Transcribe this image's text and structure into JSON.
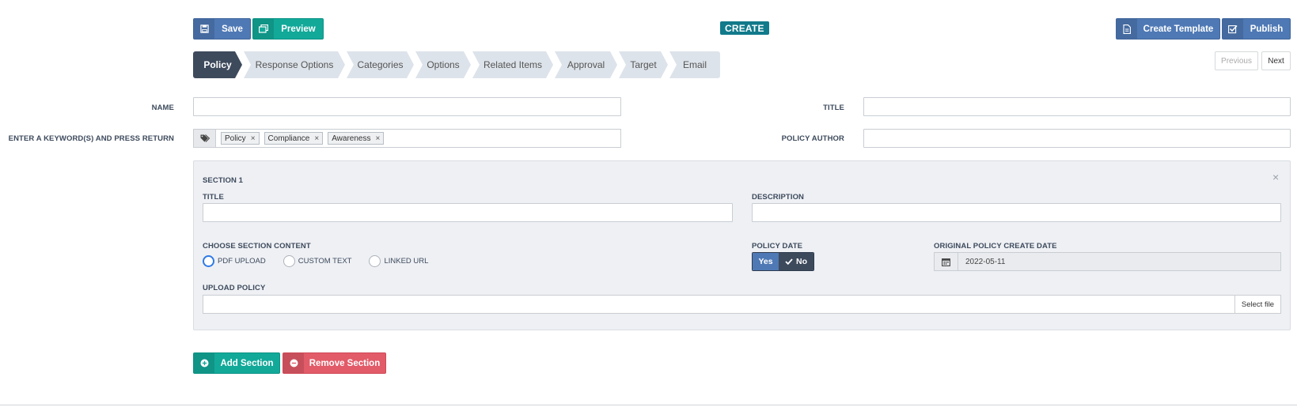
{
  "toolbar": {
    "save_label": "Save",
    "preview_label": "Preview",
    "create_badge": "CREATE",
    "create_template_label": "Create Template",
    "publish_label": "Publish"
  },
  "wizard": {
    "steps": [
      "Policy",
      "Response Options",
      "Categories",
      "Options",
      "Related Items",
      "Approval",
      "Target",
      "Email"
    ],
    "active": "Policy"
  },
  "pager": {
    "previous": "Previous",
    "next": "Next"
  },
  "form": {
    "name_label": "NAME",
    "name_value": "",
    "title_label": "TITLE",
    "title_value": "",
    "keywords_label": "ENTER A KEYWORD(S) AND PRESS RETURN",
    "keywords": [
      "Policy",
      "Compliance",
      "Awareness"
    ],
    "author_label": "POLICY AUTHOR",
    "author_value": ""
  },
  "section": {
    "heading": "SECTION 1",
    "title_label": "TITLE",
    "title_value": "",
    "description_label": "DESCRIPTION",
    "description_value": "",
    "content_label": "CHOOSE SECTION CONTENT",
    "content_options": [
      "PDF UPLOAD",
      "CUSTOM TEXT",
      "LINKED URL"
    ],
    "content_selected": "PDF UPLOAD",
    "policy_date_label": "POLICY DATE",
    "policy_date_yes": "Yes",
    "policy_date_no": "No",
    "policy_date_selected": "No",
    "original_date_label": "ORIGINAL POLICY CREATE DATE",
    "original_date_value": "2022-05-11",
    "upload_label": "UPLOAD POLICY",
    "select_file_label": "Select file",
    "close_glyph": "×"
  },
  "actions": {
    "add_section_label": "Add Section",
    "remove_section_label": "Remove Section"
  },
  "colors": {
    "primary_blue": "#4f79b5",
    "teal": "#12a999",
    "red": "#e25b68",
    "dark_step": "#3d4a5c",
    "badge": "#117a8b"
  },
  "icons": {
    "save": "floppy-disk-icon",
    "preview": "windows-icon",
    "create_template": "document-icon",
    "publish": "check-square-icon",
    "tags": "tags-icon",
    "calendar": "calendar-icon",
    "add": "plus-circle-icon",
    "remove": "minus-circle-icon"
  }
}
